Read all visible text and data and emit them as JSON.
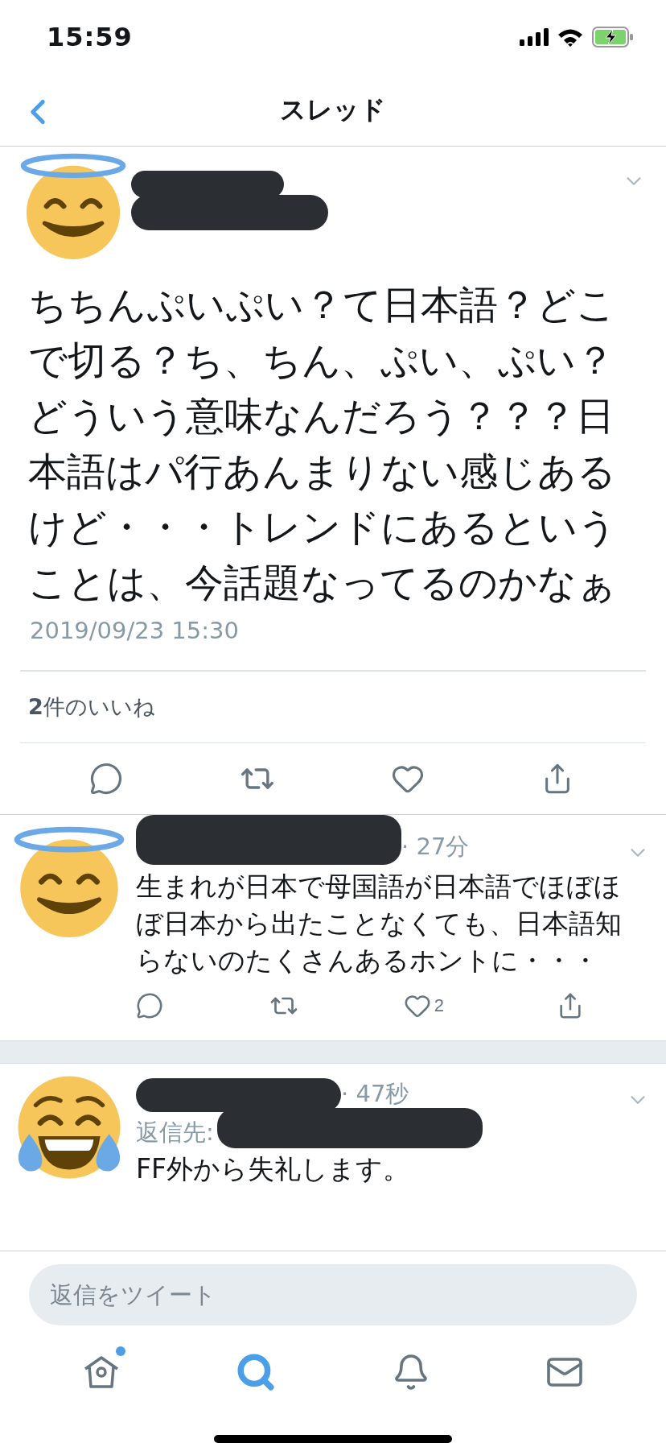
{
  "status_bar": {
    "time": "15:59"
  },
  "header": {
    "title": "スレッド"
  },
  "tweet": {
    "avatar": {
      "kind": "halo"
    },
    "text": "ちちんぷいぷい？て日本語？どこで切る？ち、ちん、ぷい、ぷい？どういう意味なんだろう？？？日本語はパ行あんまりない感じあるけど・・・トレンドにあるということは、今話題なってるのかなぁ",
    "timestamp": "2019/09/23 15:30",
    "likes": "**2**件のいいね"
  },
  "replies": [
    {
      "avatar": {
        "kind": "halo"
      },
      "time": "· 27分",
      "text": "生まれが日本で母国語が日本語でほぼほぼ日本から出たことなくても、日本語知らないのたくさんあるホントに・・・",
      "like_count": "2"
    },
    {
      "avatar": {
        "kind": "tears"
      },
      "time": "· 47秒",
      "reply_to": "返信先:",
      "text": "FF外から失礼します。"
    }
  ],
  "reply_field": {
    "placeholder": "返信をツイート"
  },
  "tab_bar": {
    "tabs": [
      {
        "kind": "home",
        "selected": false,
        "badge": true
      },
      {
        "kind": "search",
        "selected": true,
        "badge": false
      },
      {
        "kind": "notifications",
        "selected": false,
        "badge": false
      },
      {
        "kind": "messages",
        "selected": false,
        "badge": false
      }
    ]
  }
}
